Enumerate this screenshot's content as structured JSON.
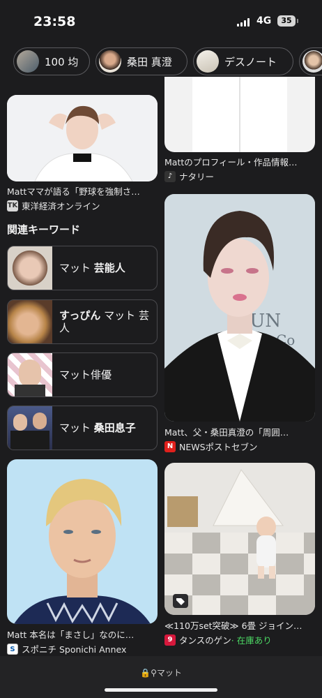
{
  "status_bar": {
    "time": "23:58",
    "network": "4G",
    "battery": "35"
  },
  "chips": [
    {
      "label": "100 均",
      "icon": "avatar-thumbnail"
    },
    {
      "label": "桑田 真澄",
      "icon": "avatar-thumbnail"
    },
    {
      "label": "デスノート",
      "icon": "avatar-thumbnail"
    },
    {
      "label": "",
      "icon": "avatar-thumbnail"
    }
  ],
  "left_column": {
    "card1": {
      "caption": "Mattママが語る「野球を強制さ…",
      "source": "東洋経済オンライン",
      "source_icon_text": "TK"
    },
    "keywords_title": "関連キーワード",
    "keywords": [
      {
        "normal": "マット ",
        "bold": "芸能人",
        "bold_first": false
      },
      {
        "bold": "すっぴん",
        "normal": " マット 芸人",
        "bold_first": true
      },
      {
        "normal": "マット俳優",
        "bold": "",
        "bold_first": false
      },
      {
        "normal": "マット ",
        "bold": "桑田息子",
        "bold_first": false
      }
    ],
    "card2": {
      "caption": "Matt 本名は「まさし」なのに…",
      "source": "スポニチ Sponichi Annex"
    }
  },
  "right_column": {
    "card1": {
      "caption": "Mattのプロフィール・作品情報…",
      "source": "ナタリー"
    },
    "card2": {
      "caption": "Matt、父・桑田真澄の「周囲…",
      "source": "NEWSポストセブン",
      "source_icon_text": "N",
      "photo_text": "JUN",
      "photo_text2": "Co"
    },
    "card3": {
      "caption": "≪110万set突破≫ 6畳 ジョイン…",
      "source": "タンスのゲン",
      "stock": " · 在庫あり",
      "source_icon_text": "9"
    }
  },
  "bottom_bar": {
    "url": "マット"
  },
  "colors": {
    "background": "#1c1c1e",
    "stock_green": "#4cd964",
    "news_red": "#e0201c"
  }
}
